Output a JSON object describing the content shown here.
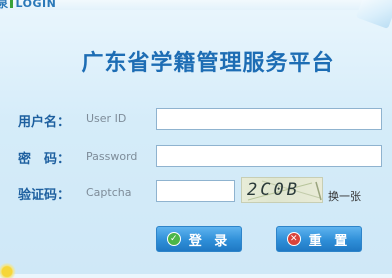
{
  "header": {
    "login_prefix": "泉",
    "login_label": "LOGIN",
    "title": "广东省学籍管理服务平台"
  },
  "form": {
    "username": {
      "label": "用户名：",
      "hint": "User ID",
      "value": ""
    },
    "password": {
      "label": "密　码：",
      "hint": "Password",
      "value": ""
    },
    "captcha": {
      "label": "验证码：",
      "hint": "Captcha",
      "value": "",
      "image_text": "2C0B",
      "refresh_label": "换一张"
    }
  },
  "buttons": {
    "login_label": "登 录",
    "reset_label": "重 置"
  },
  "colors": {
    "title": "#1d6db4",
    "label": "#1d5f9f",
    "button": "#2f8fd8",
    "login_icon": "#4cb648",
    "reset_icon": "#d9443c"
  }
}
